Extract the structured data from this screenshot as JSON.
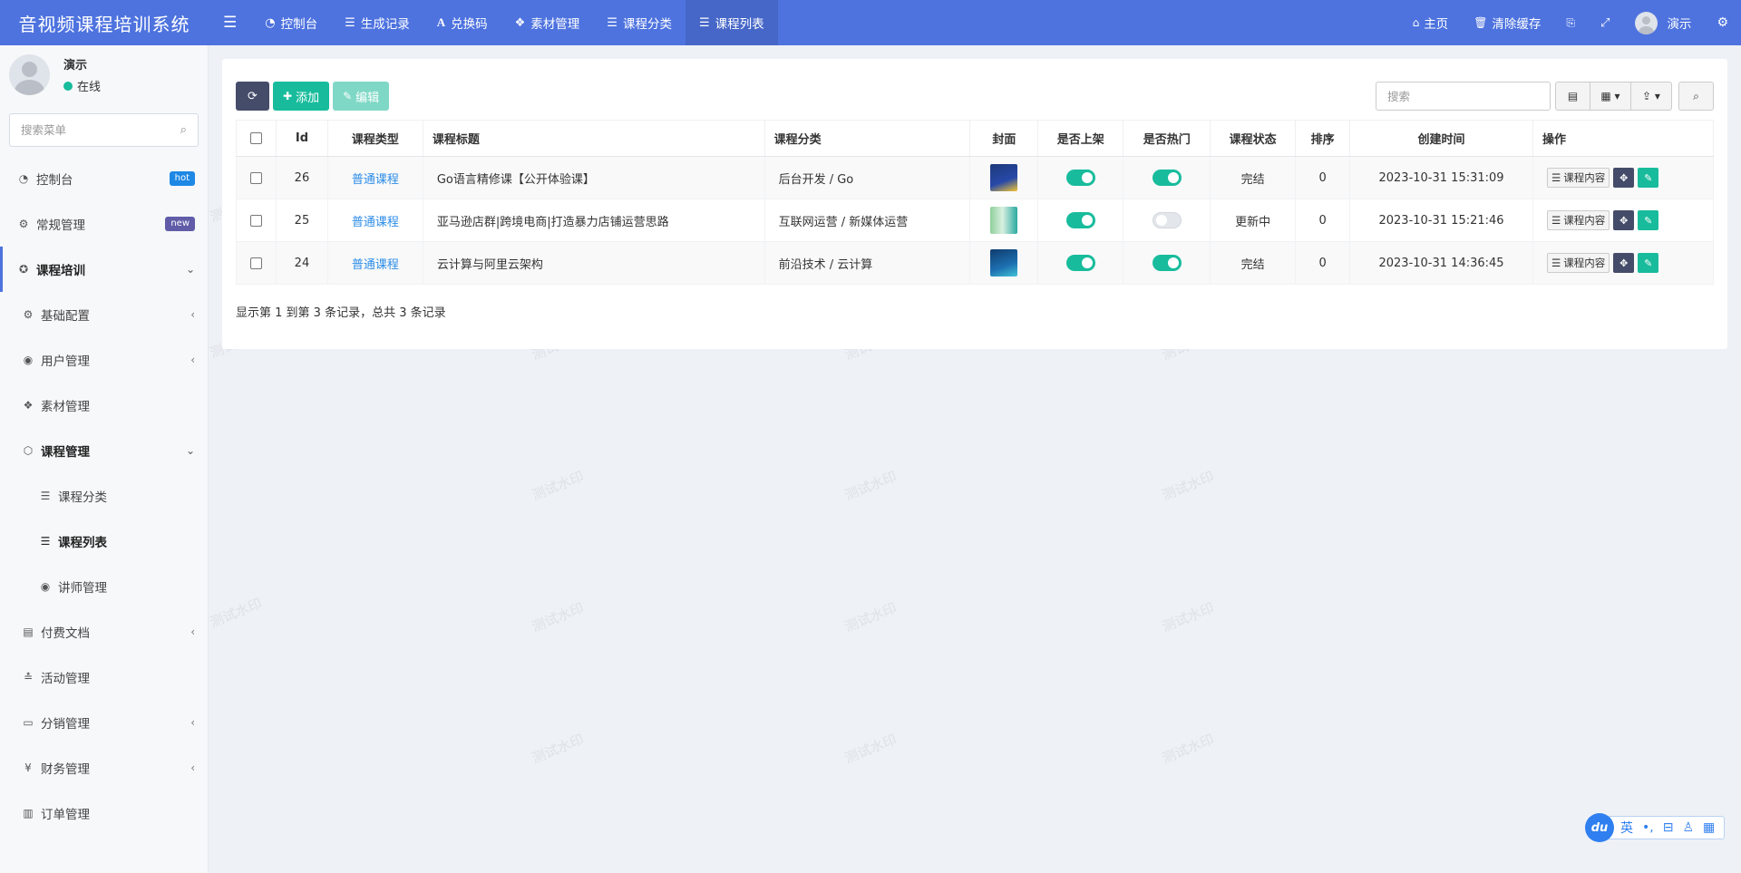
{
  "app": {
    "title": "音视频课程培训系统"
  },
  "topnav": {
    "menu_icon": "hamburger-icon",
    "items": [
      {
        "label": "控制台",
        "icon": "dashboard-icon"
      },
      {
        "label": "生成记录",
        "icon": "list-icon"
      },
      {
        "label": "兑换码",
        "icon": "font-icon"
      },
      {
        "label": "素材管理",
        "icon": "cubes-icon"
      },
      {
        "label": "课程分类",
        "icon": "list-icon"
      },
      {
        "label": "课程列表",
        "icon": "list-indent-icon"
      }
    ],
    "right": {
      "home": "主页",
      "clear_cache": "清除缓存",
      "user": "演示"
    }
  },
  "sidebar": {
    "user": {
      "name": "演示",
      "status": "在线"
    },
    "search_placeholder": "搜索菜单",
    "items": [
      {
        "label": "控制台",
        "badge": "hot"
      },
      {
        "label": "常规管理",
        "badge": "new"
      },
      {
        "label": "课程培训"
      },
      {
        "label": "基础配置"
      },
      {
        "label": "用户管理"
      },
      {
        "label": "素材管理"
      },
      {
        "label": "课程管理"
      },
      {
        "label": "课程分类"
      },
      {
        "label": "课程列表"
      },
      {
        "label": "讲师管理"
      },
      {
        "label": "付费文档"
      },
      {
        "label": "活动管理"
      },
      {
        "label": "分销管理"
      },
      {
        "label": "财务管理"
      },
      {
        "label": "订单管理"
      }
    ]
  },
  "toolbar": {
    "add_label": "添加",
    "edit_label": "编辑",
    "search_placeholder": "搜索"
  },
  "table": {
    "headers": [
      "Id",
      "课程类型",
      "课程标题",
      "课程分类",
      "封面",
      "是否上架",
      "是否热门",
      "课程状态",
      "排序",
      "创建时间",
      "操作"
    ],
    "rows": [
      {
        "id": "26",
        "type": "普通课程",
        "title": "Go语言精修课【公开体验课】",
        "category": "后台开发 / Go",
        "on_shelf": true,
        "hot": true,
        "status": "完结",
        "sort": "0",
        "created": "2023-10-31 15:31:09"
      },
      {
        "id": "25",
        "type": "普通课程",
        "title": "亚马逊店群|跨境电商|打造暴力店铺运营思路",
        "category": "互联网运营 / 新媒体运营",
        "on_shelf": true,
        "hot": false,
        "status": "更新中",
        "sort": "0",
        "created": "2023-10-31 15:21:46"
      },
      {
        "id": "24",
        "type": "普通课程",
        "title": "云计算与阿里云架构",
        "category": "前沿技术 / 云计算",
        "on_shelf": true,
        "hot": true,
        "status": "完结",
        "sort": "0",
        "created": "2023-10-31 14:36:45"
      }
    ],
    "op_label": "课程内容"
  },
  "pager": {
    "info": "显示第 1 到第 3 条记录，总共 3 条记录"
  },
  "watermark": "测试水印",
  "ime": {
    "logo": "du",
    "lang": "英",
    "punct": "•,"
  },
  "colors": {
    "header": "#4e73df",
    "green": "#18bc9c",
    "dark": "#444c69",
    "link": "#2c8de8"
  }
}
